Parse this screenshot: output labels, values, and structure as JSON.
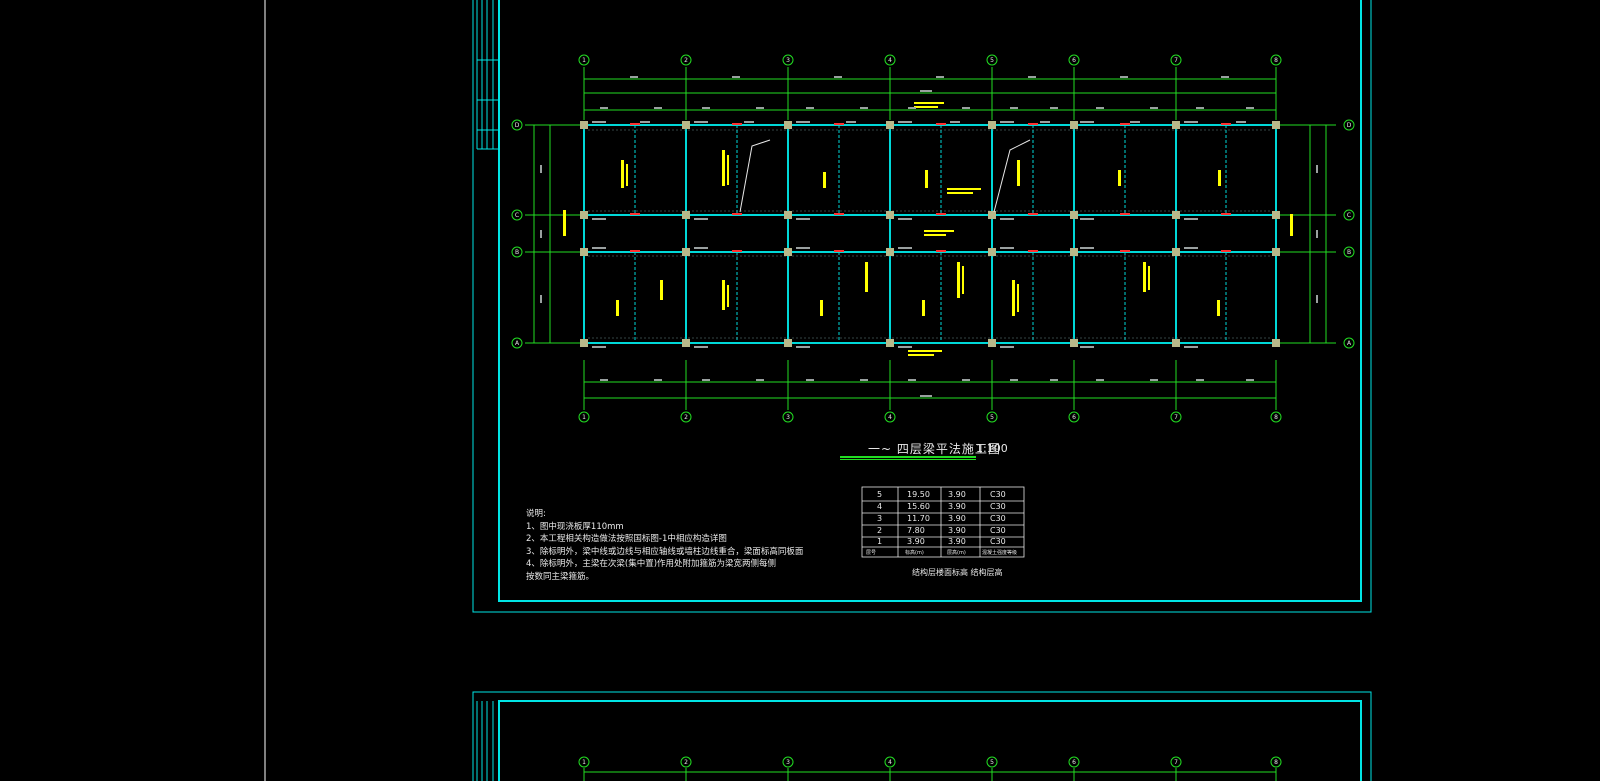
{
  "drawing": {
    "title": "一~ 四层梁平法施工图",
    "scale": "1:100",
    "grid_columns": [
      "1",
      "2",
      "3",
      "4",
      "5",
      "6",
      "7",
      "8"
    ],
    "grid_rows": [
      "D",
      "C",
      "B",
      "A"
    ],
    "colors": {
      "background": "#000000",
      "frame": "#00e5e5",
      "beams": "#00d8d8",
      "dimensions": "#22dd22",
      "annotations": "#ffff00",
      "markers": "#ff3030",
      "columns": "#b8b88a",
      "text": "#e8e8e8"
    }
  },
  "notes": {
    "heading": "说明:",
    "lines": [
      "1、图中现浇板厚110mm",
      "2、本工程相关构造做法按照国标图-1中相应构造详图",
      "3、除标明外，梁中线或边线与相应轴线或墙柱边线重合，梁面标高同板面",
      "4、除标明外，主梁在次梁(集中置)作用处附加箍筋为梁宽两侧每侧",
      "  按数同主梁箍筋。"
    ]
  },
  "floor_table": {
    "caption": "结构层楼面标高 结构层高",
    "header": [
      "层号",
      "标高(m)",
      "层高(m)",
      "混凝土强度等级"
    ],
    "rows": [
      [
        "5",
        "19.50",
        "3.90",
        "C30"
      ],
      [
        "4",
        "15.60",
        "3.90",
        "C30"
      ],
      [
        "3",
        "11.70",
        "3.90",
        "C30"
      ],
      [
        "2",
        "7.80",
        "3.90",
        "C30"
      ],
      [
        "1",
        "3.90",
        "3.90",
        "C30"
      ]
    ]
  }
}
